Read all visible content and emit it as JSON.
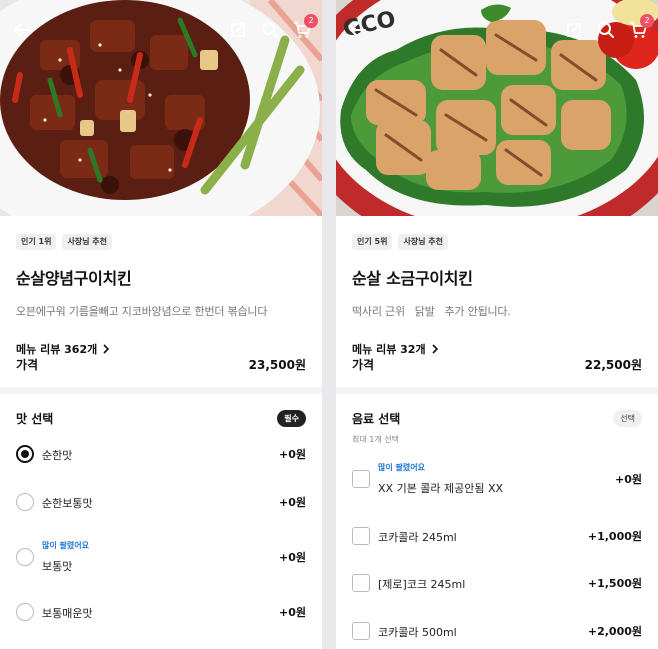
{
  "left": {
    "cart_count": "2",
    "tags": [
      "인기 1위",
      "사장님 추천"
    ],
    "title": "순살양념구이치킨",
    "description": "오븐에구워 기름을빼고 지코바양념으로 한번더 볶습니다",
    "review_link": "메뉴 리뷰 362개",
    "price_label": "가격",
    "price_value": "23,500원",
    "option_group": {
      "title": "맛 선택",
      "badge": "필수",
      "options": [
        {
          "name": "순한맛",
          "price": "+0원",
          "selected": true,
          "popular": ""
        },
        {
          "name": "순한보통맛",
          "price": "+0원",
          "selected": false,
          "popular": ""
        },
        {
          "name": "보통맛",
          "price": "+0원",
          "selected": false,
          "popular": "많이 팔렸어요"
        },
        {
          "name": "보통매운맛",
          "price": "+0원",
          "selected": false,
          "popular": ""
        }
      ]
    }
  },
  "right": {
    "cart_count": "2",
    "image_text": "GCO",
    "tags": [
      "인기 5위",
      "사장님 추천"
    ],
    "title": "순살 소금구이치킨",
    "description": "떡사리 근위   닭발   추가 안됩니다.",
    "review_link": "메뉴 리뷰 32개",
    "price_label": "가격",
    "price_value": "22,500원",
    "option_group": {
      "title": "음료 선택",
      "badge": "선택",
      "subtitle": "최대 1개 선택",
      "options": [
        {
          "name": "XX 기본 콜라 제공안됨 XX",
          "price": "+0원",
          "popular": "많이 팔렸어요"
        },
        {
          "name": "코카콜라 245ml",
          "price": "+1,000원",
          "popular": ""
        },
        {
          "name": "[제로]코크 245ml",
          "price": "+1,500원",
          "popular": ""
        },
        {
          "name": "코카콜라 500ml",
          "price": "+2,000원",
          "popular": ""
        }
      ]
    }
  },
  "colors": {
    "accent_blue": "#1a73d6",
    "badge_pink": "#f04f68",
    "background": "#f3f3f5"
  },
  "icons": [
    "back-arrow-icon",
    "share-icon",
    "search-icon",
    "cart-icon",
    "chevron-right-icon"
  ]
}
